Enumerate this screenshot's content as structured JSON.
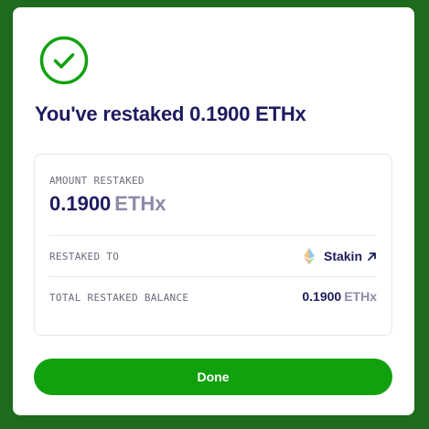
{
  "title": "You've restaked 0.1900 ETHx",
  "amount": {
    "label": "AMOUNT RESTAKED",
    "value": "0.1900",
    "unit": "ETHx"
  },
  "restaked_to": {
    "label": "RESTAKED TO",
    "provider": "Stakin",
    "provider_icon": "ethereum-icon",
    "link_icon": "external-link-icon"
  },
  "total_balance": {
    "label": "TOTAL RESTAKED BALANCE",
    "value": "0.1900",
    "unit": "ETHx"
  },
  "done_label": "Done",
  "icons": {
    "success": "check-circle-icon"
  },
  "colors": {
    "background": "#1e6b1e",
    "accent": "#11a10e",
    "title": "#1d1b5e",
    "muted_unit": "#8c8aa8"
  }
}
